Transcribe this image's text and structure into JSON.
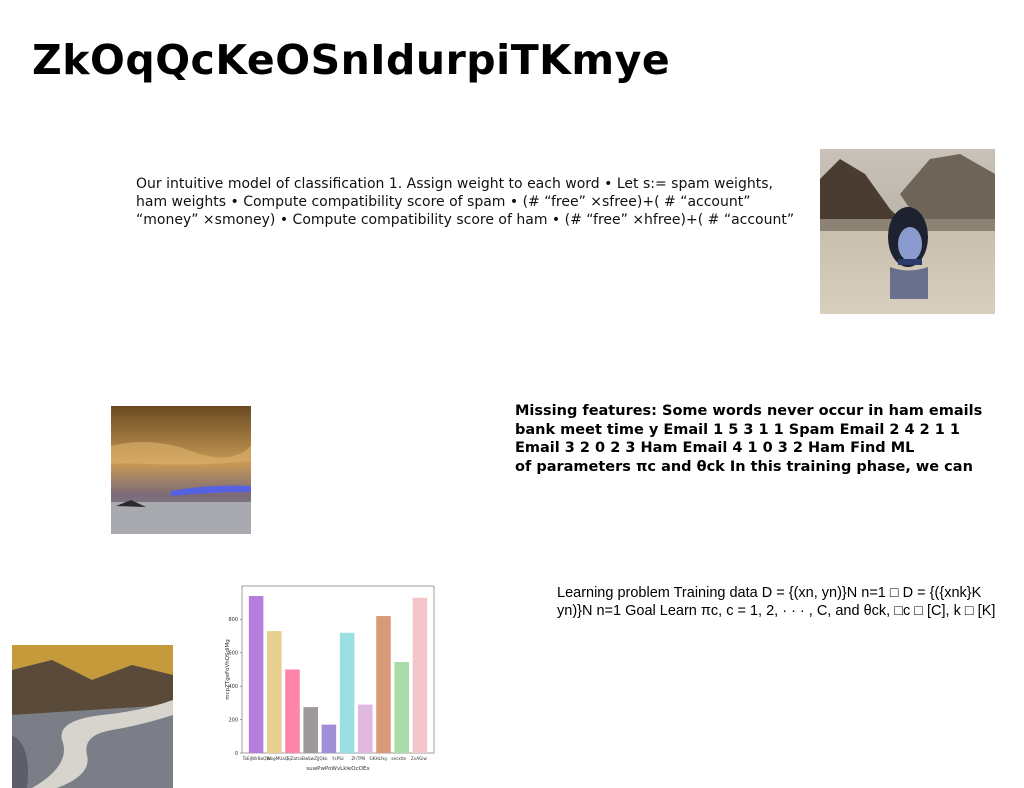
{
  "slide": {
    "title": "ZkOqQcKeOSnIdurpiTKmye",
    "text_block_1": [
      "Our intuitive model of classification 1. Assign weight to each word • Let s:= spam weights,",
      "ham weights • Compute compatibility score of spam • (# “free” ×sfree)+( # “account”",
      "“money” ×smoney) • Compute compatibility score of ham • (# “free” ×hfree)+( # “account”"
    ],
    "text_block_2": [
      "Missing features: Some words never occur in ham emails",
      "bank meet time y Email 1 5 3 1 1 Spam Email 2 4 2 1 1",
      "Email 3 2 0 2 3 Ham Email 4 1 0 3 2 Ham Find ML",
      "of parameters πc and θck In this training phase, we can"
    ],
    "text_block_3": [
      "Learning problem Training data D = {(xn, yn)}N n=1 □ D = {({xnk}K",
      "yn)}N n=1 Goal Learn πc, c = 1, 2, · · · , C, and θck, □c □ [C], k □ [K]"
    ]
  },
  "images": {
    "water": "woman-in-water-photo",
    "sky": "dramatic-sky-photo",
    "glacier": "glacier-valley-photo"
  },
  "chart_data": {
    "type": "bar",
    "title": "",
    "xlabel": "suwPwPoWvLkleOcOEx",
    "ylabel": "mcpZTgeFoVhQSdiMg",
    "ylim": [
      0,
      1000
    ],
    "yticks": [
      0,
      200,
      400,
      600,
      800
    ],
    "categories": [
      "ToEiJWrBoQXc",
      "WegMUaQ",
      "SjZatraBw",
      "SwZjJQkk",
      "YsPSc",
      "ZhTPN",
      "GKHLfxy",
      "secxtle",
      "ZvAGiw"
    ],
    "category_labels_shown": [
      "ToEiJWrBoQXc",
      "WegMUaQ",
      "SjZatraBw",
      "SwZjJQkk",
      "YsPSc",
      "ZhTPN",
      "GKHLfxy",
      "secxtle",
      "ZvAGiw"
    ],
    "values": [
      940,
      730,
      500,
      275,
      170,
      720,
      290,
      820,
      545,
      930
    ],
    "colors": [
      "#b57edc",
      "#e6cf8f",
      "#ff85a8",
      "#9e9a9a",
      "#a08fd8",
      "#9be0e0",
      "#e0b8e0",
      "#d99a7a",
      "#a9dca8",
      "#f4c6cc"
    ],
    "grid": false
  }
}
